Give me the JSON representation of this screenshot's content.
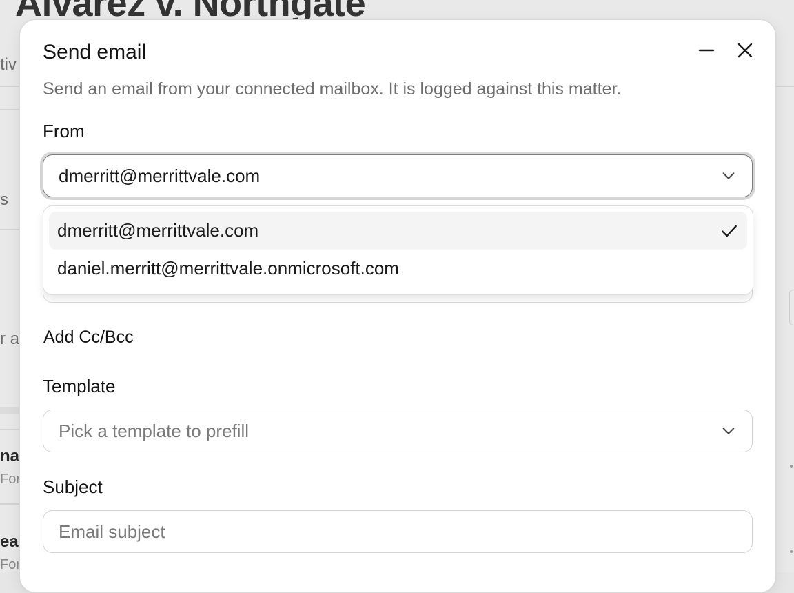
{
  "background": {
    "title": "Alvarez v. Northgate",
    "left_fragments": [
      "tiv",
      "s",
      "r a",
      "na",
      "For",
      "eal",
      "For"
    ]
  },
  "modal": {
    "title": "Send email",
    "description": "Send an email from your connected mailbox. It is logged against this matter.",
    "minimize_icon": "minus-icon",
    "close_icon": "close-icon"
  },
  "from": {
    "label": "From",
    "value": "dmerritt@merrittvale.com",
    "options": [
      {
        "label": "dmerritt@merrittvale.com",
        "selected": true
      },
      {
        "label": "daniel.merritt@merrittvale.onmicrosoft.com",
        "selected": false
      }
    ]
  },
  "cc_bcc": {
    "label": "Add Cc/Bcc"
  },
  "template": {
    "label": "Template",
    "placeholder": "Pick a template to prefill"
  },
  "subject": {
    "label": "Subject",
    "placeholder": "Email subject"
  }
}
